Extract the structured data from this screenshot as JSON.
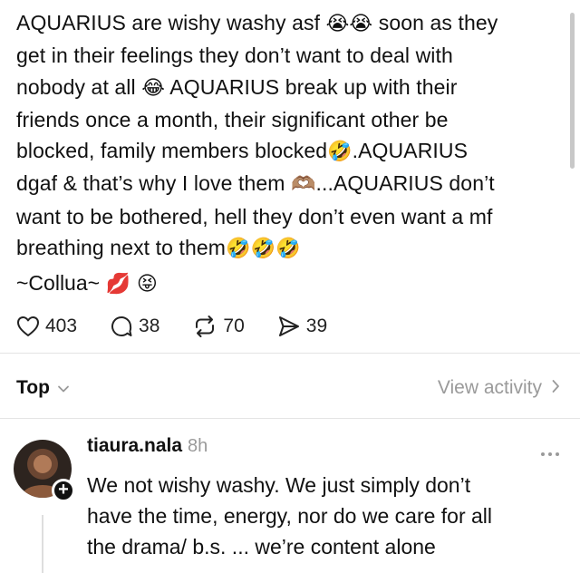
{
  "post": {
    "lines": [
      [
        "AQUARIUS are wishy washy asf ",
        "😭😭",
        " soon as they"
      ],
      [
        "get in their feelings they don’t want to deal with",
        "",
        ""
      ],
      [
        "nobody at all ",
        "😂",
        " AQUARIUS break up with their"
      ],
      [
        "friends once a month, their significant other be",
        "",
        ""
      ],
      [
        "blocked, family members blocked",
        "🤣",
        ".AQUARIUS"
      ],
      [
        "dgaf & that’s why I love them ",
        "🫶🏽",
        "...AQUARIUS don’t"
      ],
      [
        "want to be bothered, hell they don’t even want a mf",
        "",
        ""
      ],
      [
        "breathing next to them",
        "🤣🤣🤣",
        ""
      ]
    ],
    "signature_text": "~Collua~ ",
    "signature_emoji": "💋 😝"
  },
  "actions": {
    "likes": "403",
    "replies": "38",
    "reposts": "70",
    "shares": "39"
  },
  "sort": {
    "label": "Top",
    "view_activity": "View activity"
  },
  "reply": {
    "username": "tiaura.nala",
    "time": "8h",
    "lines": [
      "We not wishy washy. We just simply don’t",
      "have the time, energy, nor do we care for all",
      "the drama/ b.s. ... we’re content alone"
    ]
  },
  "icons": {
    "like": "heart-icon",
    "reply": "comment-bubble-icon",
    "repost": "repost-icon",
    "share": "send-icon",
    "sort": "chevron-down-icon",
    "view_activity": "chevron-right-icon",
    "more": "more-dots-icon",
    "follow": "plus-icon"
  }
}
